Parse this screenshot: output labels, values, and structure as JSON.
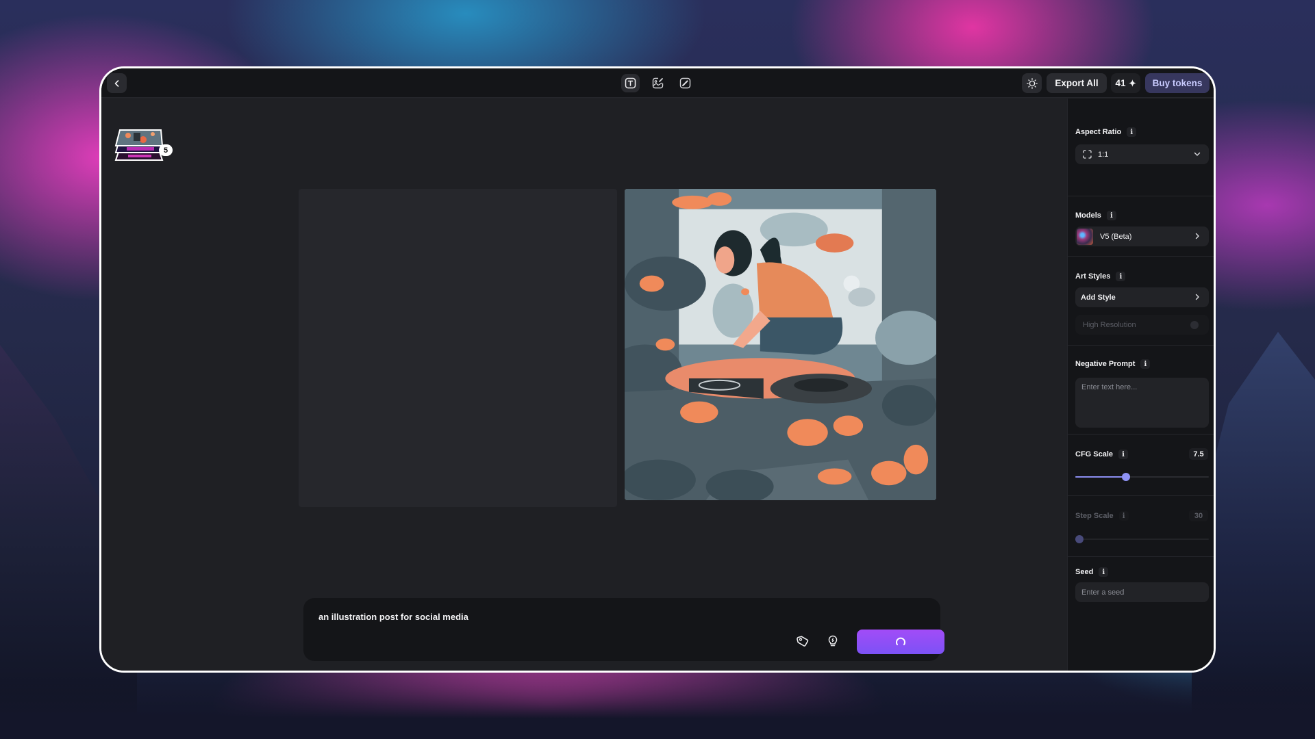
{
  "topbar": {
    "back_icon": "chevron-left-icon",
    "modes": [
      {
        "name": "text-to-image",
        "icon": "text-t-icon",
        "active": true
      },
      {
        "name": "image-to-image",
        "icon": "image-edit-icon",
        "active": false
      },
      {
        "name": "sketch",
        "icon": "brush-icon",
        "active": false
      }
    ],
    "theme_icon": "sun-icon",
    "export_label": "Export All",
    "credits": "41",
    "credits_icon": "sparkle-icon",
    "buy_label": "Buy tokens"
  },
  "canvas": {
    "history_count": "5",
    "prompt": "an illustration post for social media",
    "prompt_actions": [
      {
        "name": "tag",
        "icon": "tag-icon"
      },
      {
        "name": "idea",
        "icon": "lightbulb-icon"
      }
    ],
    "generate_state": "loading",
    "generate_icon": "spinner-icon",
    "result_image_description": "Flat illustration of a woman with black hair in an orange shirt kneeling beside turntables amid teal foliage and orange leaves, with a fish and a white bird"
  },
  "panel": {
    "aspect_ratio": {
      "label": "Aspect Ratio",
      "value": "1:1",
      "icon": "crop-frame-icon"
    },
    "models": {
      "label": "Models",
      "value": "V5 (Beta)"
    },
    "art_styles": {
      "label": "Art Styles",
      "add_label": "Add Style",
      "high_res_label": "High Resolution",
      "high_res_enabled": false
    },
    "negative_prompt": {
      "label": "Negative Prompt",
      "placeholder": "Enter text here...",
      "value": ""
    },
    "cfg_scale": {
      "label": "CFG Scale",
      "value": "7.5",
      "fraction": 0.38
    },
    "step_scale": {
      "label": "Step Scale",
      "value": "30",
      "fraction": 0.0,
      "disabled": true
    },
    "seed": {
      "label": "Seed",
      "placeholder": "Enter a seed",
      "value": ""
    },
    "info_glyph": "i"
  },
  "colors": {
    "accent": "#8f93f5",
    "generate_gradient": [
      "#a24cf7",
      "#7c52f6"
    ],
    "buy_bg": "#37375e",
    "buy_text": "#c9cbff"
  }
}
